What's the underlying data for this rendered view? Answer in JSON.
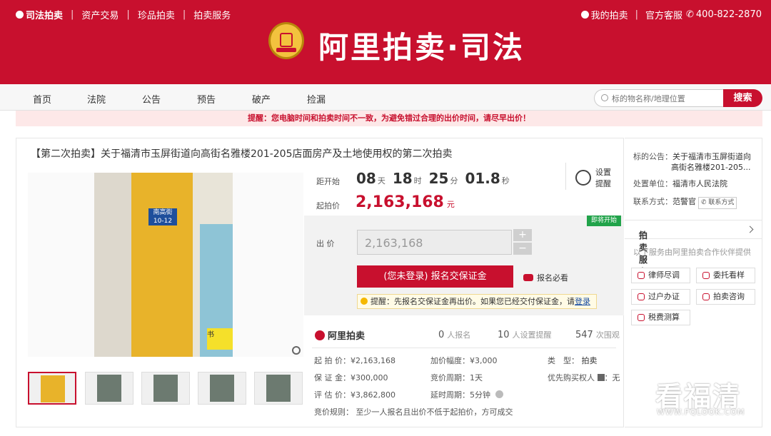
{
  "header": {
    "brand": "司法拍卖",
    "links": [
      "资产交易",
      "珍品拍卖",
      "拍卖服务"
    ],
    "my_auction": "我的拍卖",
    "service": "官方客服",
    "phone": "400-822-2870",
    "logo_text": "阿里拍卖·司法"
  },
  "nav": {
    "items": [
      "首页",
      "法院",
      "公告",
      "预告",
      "破产",
      "捡漏"
    ],
    "search_placeholder": "标的物名称/地理位置",
    "search_button": "搜索"
  },
  "notice": "提醒：您电脑时间和拍卖时间不一致，为避免错过合理的出价时间，请尽早出价！",
  "auction": {
    "title": "【第二次拍卖】关于福清市玉屏街道向高街名雅楼201-205店面房产及土地使用权的第二次拍卖",
    "countdown_label": "距开始",
    "days": "08",
    "days_unit": "天",
    "hours": "18",
    "hours_unit": "时",
    "minutes": "25",
    "minutes_unit": "分",
    "seconds": "01.8",
    "seconds_unit": "秒",
    "start_price_label": "起拍价",
    "start_price": "2,163,168",
    "price_unit": "元",
    "remind_line1": "设置",
    "remind_line2": "提醒",
    "status_badge": "即将开始",
    "bid_label": "出  价",
    "bid_value": "2,163,168",
    "plus": "+",
    "minus": "−",
    "register_button": "(您未登录) 报名交保证金",
    "must_read": "报名必看",
    "tip_text": "提醒：先报名交保证金再出价。如果您已经交付保证金，请",
    "tip_login": "登录",
    "photo_sign": "南高街 10-12",
    "photo_shop": "书",
    "alilogo": "阿里拍卖",
    "signed_up": "0",
    "signed_up_label": "人报名",
    "reminders": "10",
    "reminders_label": "人设置提醒",
    "views": "547",
    "views_label": "次围观",
    "details": {
      "start_price": "起 拍 价：¥2,163,168",
      "increment": "加价幅度：¥3,000",
      "type_label": "类　型：",
      "type_value": "拍卖",
      "deposit": "保 证 金：¥300,000",
      "cycle": "竞价周期：1天",
      "priority": "优先购买权人",
      "priority_value": "无",
      "appraisal": "评 估 价：¥3,862,800",
      "extension": "延时周期：5分钟",
      "rule": "竞价规则：  至少一人报名且出价不低于起拍价，方可成交"
    }
  },
  "sidebar": {
    "notice_label": "标的公告：",
    "notice_value_1": "关于福清市玉屏街道向",
    "notice_value_2": "高街名雅楼201-205...",
    "unit_label": "处置单位：",
    "unit_value": "福清市人民法院",
    "contact_label": "联系方式：",
    "contact_name": "范警官",
    "contact_tag": "联系方式",
    "services_title": "拍卖服务",
    "services_desc": "以下服务由阿里拍卖合作伙伴提供",
    "services": [
      "律师尽调",
      "委托看样",
      "过户办证",
      "拍卖咨询",
      "税费测算"
    ]
  },
  "watermark": {
    "main": "看福清",
    "url": "WWW.FQLOOK.COM"
  }
}
